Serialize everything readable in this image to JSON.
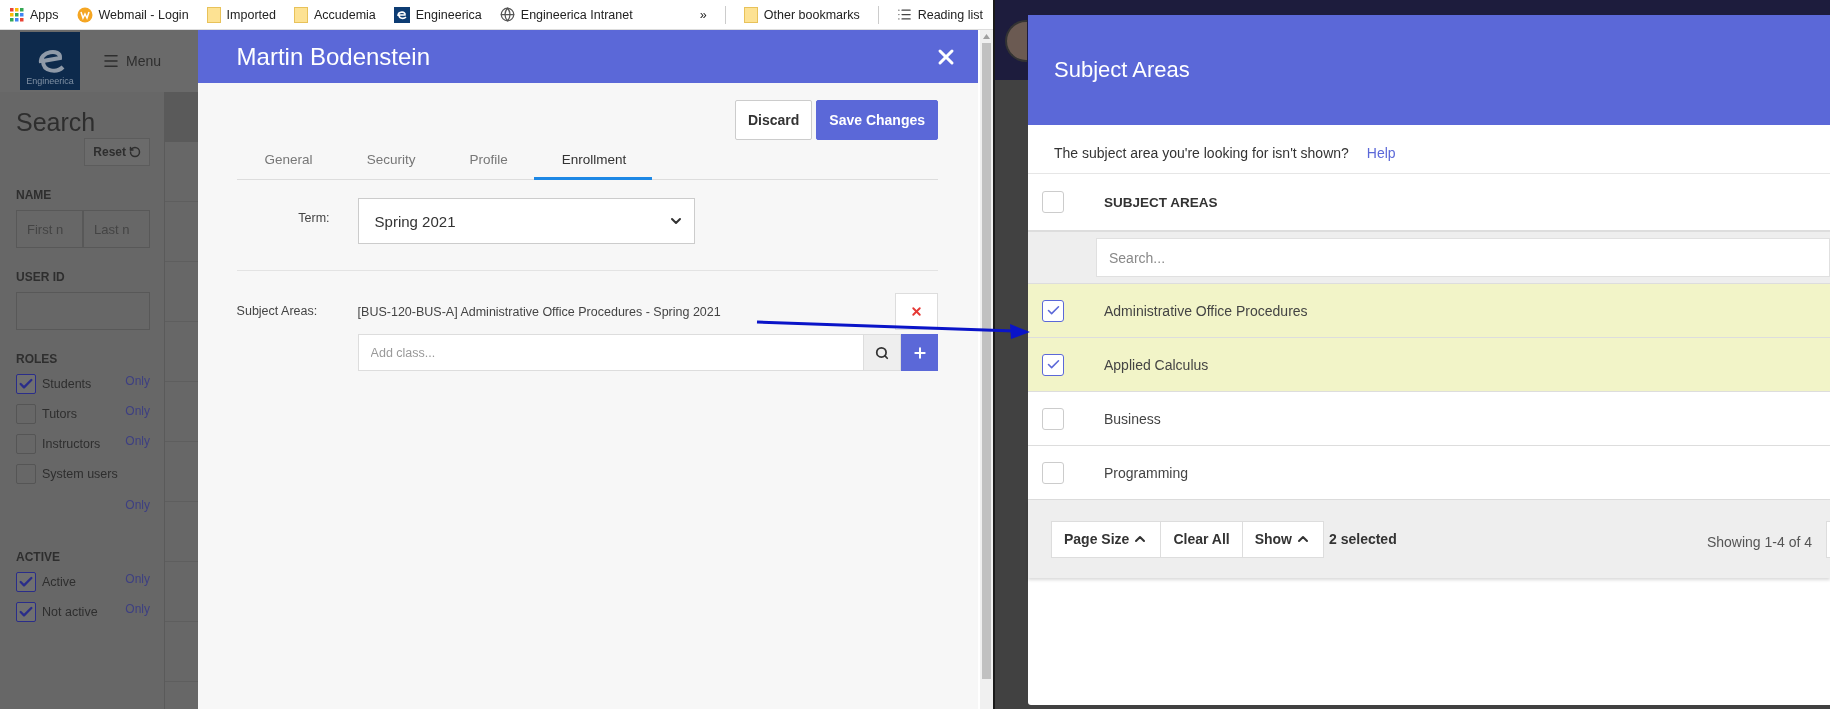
{
  "bookmarks_bar": {
    "items": [
      {
        "kind": "apps",
        "label": "Apps"
      },
      {
        "kind": "webmail",
        "label": "Webmail - Login"
      },
      {
        "kind": "folder",
        "label": "Imported"
      },
      {
        "kind": "folder",
        "label": "Accudemia"
      },
      {
        "kind": "logo",
        "label": "Engineerica"
      },
      {
        "kind": "globe",
        "label": "Engineerica Intranet"
      }
    ],
    "overflow": "»",
    "end_items": [
      {
        "kind": "folder",
        "label": "Other bookmarks"
      },
      {
        "kind": "reading",
        "label": "Reading list"
      }
    ]
  },
  "app_header": {
    "logo_text": "Engineerica",
    "menu": "Menu"
  },
  "sidebar": {
    "title": "Search",
    "reset": "Reset",
    "name_label": "NAME",
    "name_fields": [
      {
        "placeholder": "First n"
      },
      {
        "placeholder": "Last n"
      }
    ],
    "user_id_label": "USER ID",
    "sections": [
      {
        "title": "ROLES",
        "options": [
          {
            "label": "Students",
            "checked": true,
            "only": "Only"
          },
          {
            "label": "Tutors",
            "checked": false,
            "only": "Only"
          },
          {
            "label": "Instructors",
            "checked": false,
            "only": "Only"
          },
          {
            "label": "System users",
            "checked": false,
            "only": "Only"
          }
        ]
      },
      {
        "title": "ACTIVE",
        "options": [
          {
            "label": "Active",
            "checked": true,
            "only": "Only"
          },
          {
            "label": "Not active",
            "checked": true,
            "only": "Only"
          }
        ]
      }
    ]
  },
  "dialog": {
    "title": "Martin Bodenstein",
    "buttons": [
      {
        "label": "Discard",
        "kind": "secondary"
      },
      {
        "label": "Save Changes",
        "kind": "primary"
      }
    ],
    "tabs": [
      {
        "label": "General",
        "selected": false
      },
      {
        "label": "Security",
        "selected": false
      },
      {
        "label": "Profile",
        "selected": false
      },
      {
        "label": "Enrollment",
        "selected": true
      }
    ],
    "term": {
      "label": "Term:",
      "value": "Spring 2021"
    },
    "subject_areas": {
      "label": "Subject Areas:",
      "items": [
        "[BUS-120-BUS-A] Administrative Office Procedures - Spring 2021"
      ],
      "add_placeholder": "Add class..."
    }
  },
  "subject_panel": {
    "title": "Subject Areas",
    "help_text": "The subject area you're looking for isn't shown?",
    "help_link": "Help",
    "header": {
      "label": "SUBJECT AREAS",
      "checked": false
    },
    "search_placeholder": "Search...",
    "rows": [
      {
        "label": "Administrative Office Procedures",
        "checked": true
      },
      {
        "label": "Applied Calculus",
        "checked": true
      },
      {
        "label": "Business",
        "checked": false
      },
      {
        "label": "Programming",
        "checked": false
      }
    ],
    "footer": {
      "buttons": [
        {
          "label": "Page Size",
          "kind": "dropdown"
        },
        {
          "label": "Clear All",
          "kind": "action"
        },
        {
          "label": "Show",
          "kind": "dropdown"
        }
      ],
      "selected_count": "2 selected",
      "range": "Showing 1-4 of 4"
    }
  }
}
